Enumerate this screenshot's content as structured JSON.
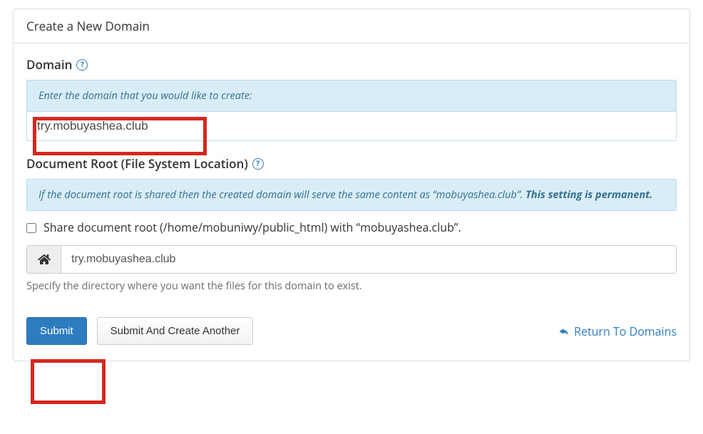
{
  "panel": {
    "title": "Create a New Domain"
  },
  "domain_section": {
    "label": "Domain",
    "hint": "Enter the domain that you would like to create:",
    "value": "try.mobuyashea.club"
  },
  "docroot_section": {
    "label": "Document Root (File System Location)",
    "hint_pre": "If the document root is shared then the created domain will serve the same content as “mobuyashea.club”. ",
    "hint_strong": "This setting is permanent.",
    "checkbox_label": "Share document root (/home/mobuniwy/public_html) with “mobuyashea.club”.",
    "directory_value": "try.mobuyashea.club",
    "help_text": "Specify the directory where you want the files for this domain to exist."
  },
  "buttons": {
    "submit": "Submit",
    "submit_another": "Submit And Create Another",
    "return": "Return To Domains"
  },
  "icons": {
    "help": "?",
    "home": "home-icon",
    "return_arrow": "reply-arrow-icon"
  },
  "colors": {
    "primary": "#2e7cc0",
    "info_bg": "#d9edf7",
    "highlight": "#d5281e"
  }
}
